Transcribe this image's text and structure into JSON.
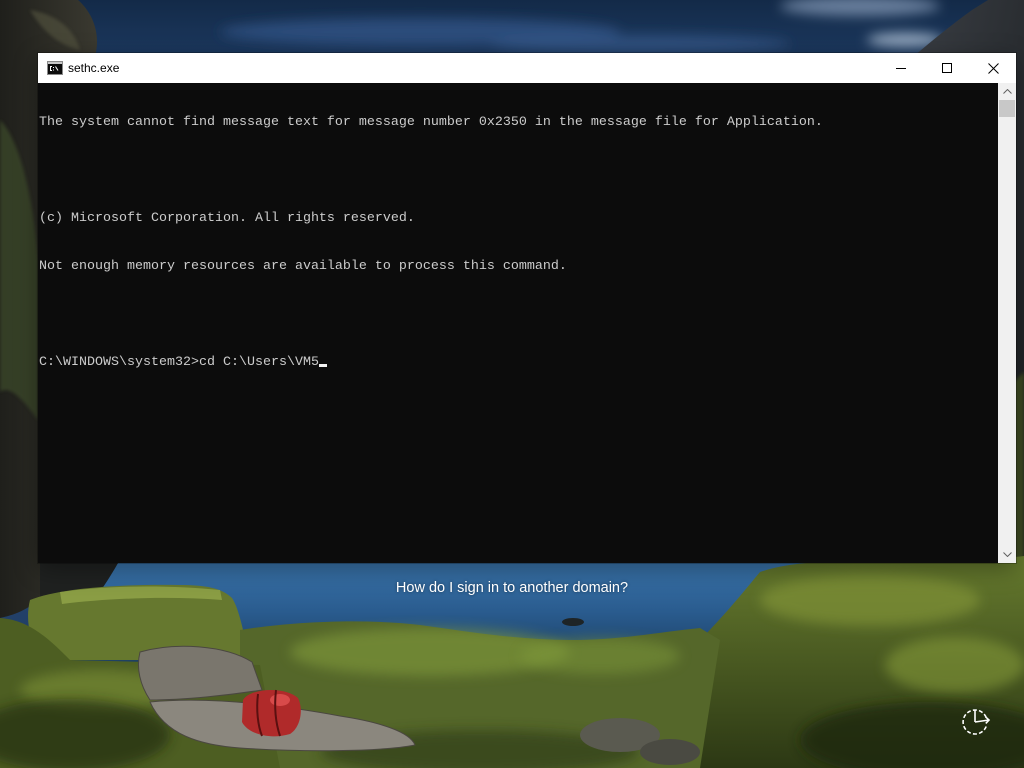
{
  "window": {
    "title": "sethc.exe",
    "app_icon": "cmd-icon",
    "minimize_icon": "minimize-icon",
    "maximize_icon": "maximize-icon",
    "close_icon": "close-icon"
  },
  "console": {
    "output": [
      "The system cannot find message text for message number 0x2350 in the message file for Application.",
      "(c) Microsoft Corporation. All rights reserved.",
      "Not enough memory resources are available to process this command."
    ],
    "prompt": "C:\\WINDOWS\\system32>",
    "input": "cd C:\\Users\\VM5",
    "scrollbar": {
      "scroll_percent": 0,
      "up_icon": "chevron-up-icon",
      "down_icon": "chevron-down-icon"
    }
  },
  "lock_screen": {
    "sign_in_help_link": "How do I sign in to another domain?",
    "ease_of_access_icon": "ease-of-access-icon"
  },
  "colors": {
    "console_background": "#0c0c0c",
    "console_text": "#cccccc",
    "cursor": "#f2f2f2",
    "title_bar": "#ffffff",
    "scrollbar_track": "#f0f0f0",
    "scrollbar_thumb": "#c8c8c8",
    "lock_screen_text": "#ffffff"
  }
}
